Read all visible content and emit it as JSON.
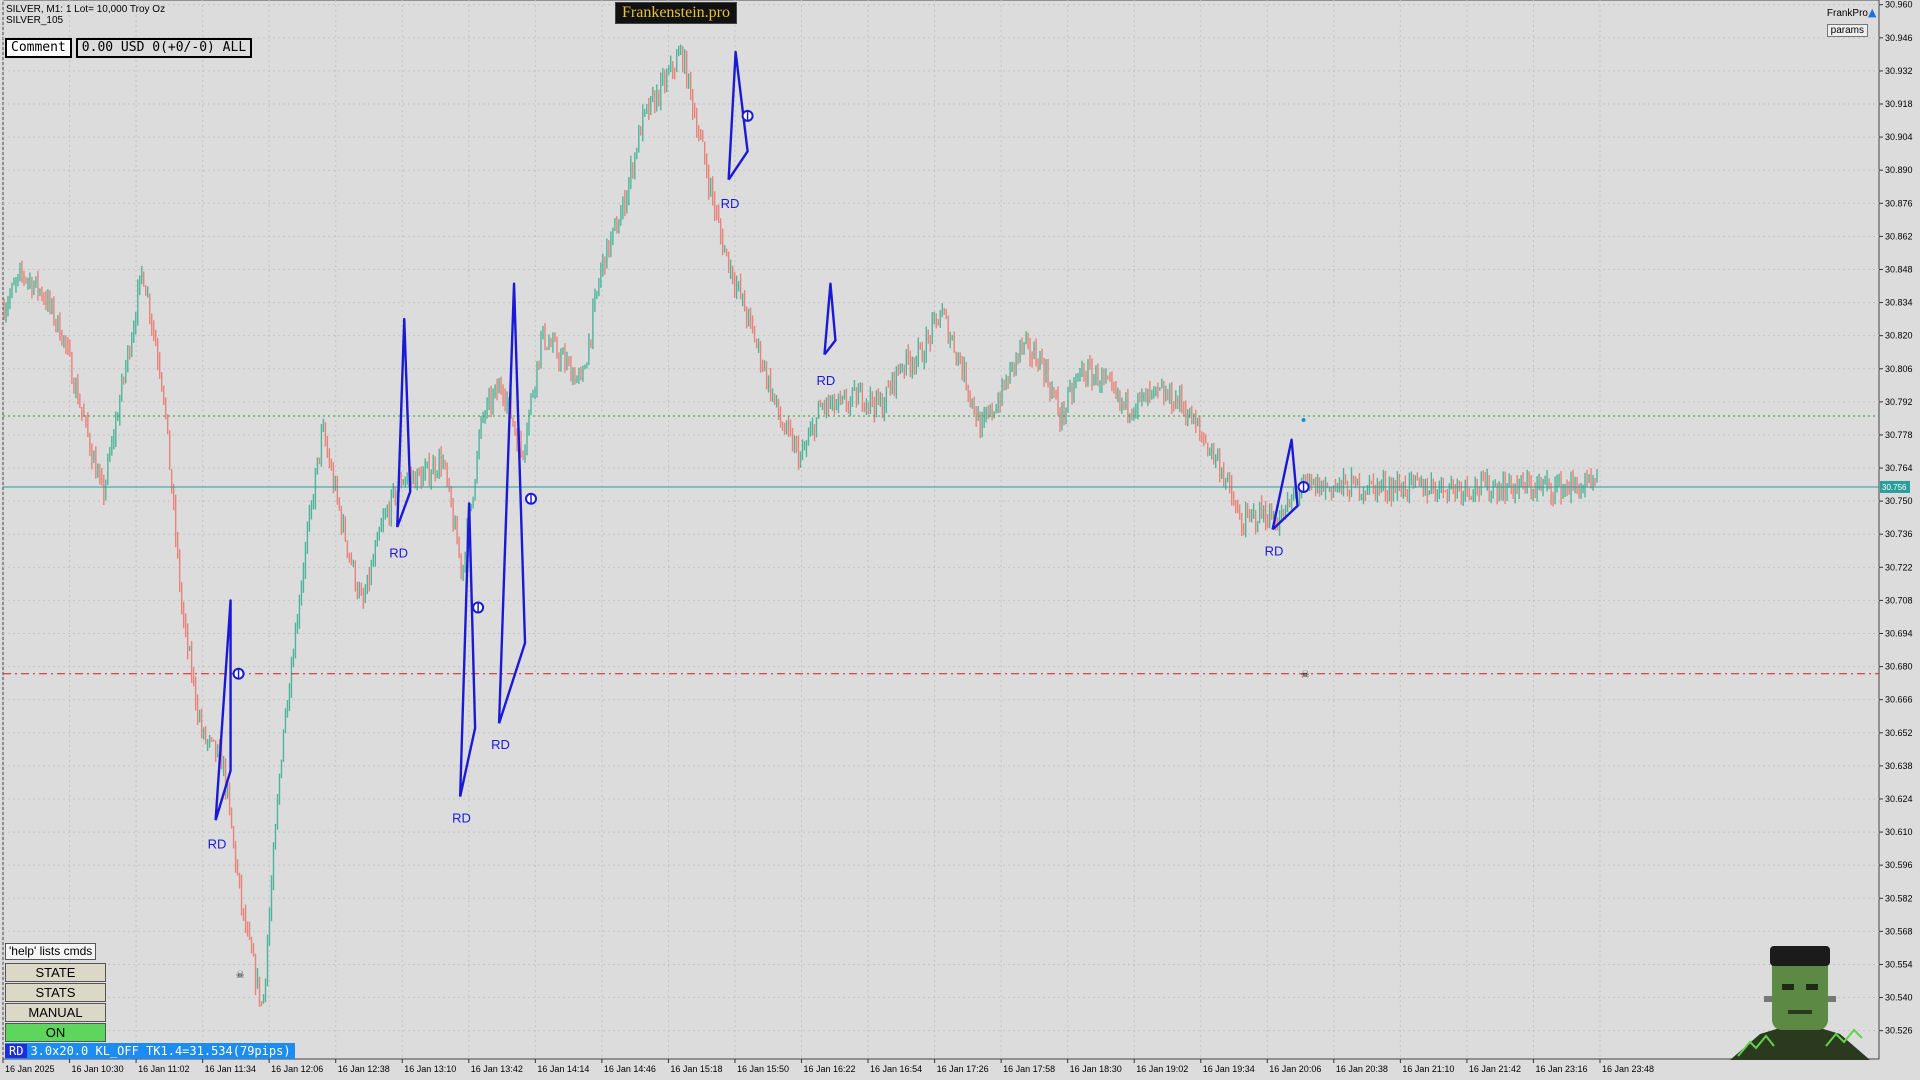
{
  "window": {
    "symbol_line": "SILVER, M1:  1 Lot= 10,000 Troy Oz",
    "sub_line": "SILVER_105",
    "brand": "Frankenstein.pro",
    "top_right_label": "FrankPro",
    "params_label": "params"
  },
  "comment": {
    "label": "Comment",
    "value": "0.00 USD 0(+0/-0) ALL"
  },
  "panel": {
    "help": "'help' lists cmds",
    "buttons": [
      "STATE",
      "STATS",
      "MANUAL",
      "ON"
    ],
    "status_tag": "RD",
    "status_text": "3.0x20.0 KL_OFF TK1.4=31.534(79pips)"
  },
  "colors": {
    "bull": "#4fb59a",
    "bear": "#e8837a",
    "pattern": "#1a1ad6",
    "bg": "#dcdcdc",
    "grid": "#c4c4c4",
    "green_level": "#2e9b2e",
    "red_level": "#d02020",
    "price_line": "#2a9d9d"
  },
  "chart_data": {
    "type": "line",
    "series": [
      {
        "x": [
          0,
          20,
          40,
          60,
          80,
          100,
          120,
          140,
          160,
          180,
          200,
          220,
          240,
          260,
          280,
          300,
          320,
          340,
          360,
          380,
          400,
          420,
          440,
          460,
          480,
          500,
          520,
          540,
          560,
          580,
          600,
          620,
          640,
          660,
          680,
          700,
          720,
          740,
          760,
          780,
          800,
          820,
          840,
          860,
          880,
          900,
          920,
          940,
          960,
          980,
          1000,
          1020,
          1040,
          1060,
          1080,
          1100,
          1120,
          1140,
          1160,
          1180,
          1200,
          1220,
          1240,
          1260,
          1280,
          1300,
          1320,
          1340,
          1360,
          1380,
          1400,
          1420,
          1440,
          1460,
          1480,
          1500,
          1520,
          1540,
          1560,
          1580,
          1600
        ],
        "values": [
          30.832,
          30.846,
          30.838,
          30.82,
          30.786,
          30.752,
          30.8,
          30.848,
          30.8,
          30.7,
          30.65,
          30.64,
          30.575,
          30.535,
          30.65,
          30.72,
          30.78,
          30.74,
          30.705,
          30.74,
          30.76,
          30.76,
          30.768,
          30.72,
          30.785,
          30.8,
          30.77,
          30.82,
          30.81,
          30.8,
          30.85,
          30.872,
          30.91,
          30.925,
          30.94,
          30.9,
          30.86,
          30.835,
          30.81,
          30.782,
          30.768,
          30.79,
          30.79,
          30.795,
          30.79,
          30.808,
          30.812,
          30.83,
          30.808,
          30.78,
          30.795,
          30.815,
          30.81,
          30.785,
          30.805,
          30.802,
          30.79,
          30.792,
          30.795,
          30.792,
          30.778,
          30.765,
          30.74,
          30.745,
          30.742,
          30.756,
          30.756,
          30.756,
          30.756,
          30.756,
          30.756,
          30.756,
          30.756,
          30.756,
          30.756,
          30.756,
          30.756,
          30.756,
          30.756,
          30.756,
          30.756
        ]
      }
    ],
    "x_tick_labels": [
      "16 Jan 2025",
      "16 Jan 10:30",
      "16 Jan 11:02",
      "16 Jan 11:34",
      "16 Jan 12:06",
      "16 Jan 12:38",
      "16 Jan 13:10",
      "16 Jan 13:42",
      "16 Jan 14:14",
      "16 Jan 14:46",
      "16 Jan 15:18",
      "16 Jan 15:50",
      "16 Jan 16:22",
      "16 Jan 16:54",
      "16 Jan 17:26",
      "16 Jan 17:58",
      "16 Jan 18:30",
      "16 Jan 19:02",
      "16 Jan 19:34",
      "16 Jan 20:06",
      "16 Jan 20:38",
      "16 Jan 21:10",
      "16 Jan 21:42",
      "16 Jan 23:16",
      "16 Jan 23:48"
    ],
    "y_tick_labels": [
      "30.960",
      "30.946",
      "30.932",
      "30.918",
      "30.904",
      "30.890",
      "30.876",
      "30.862",
      "30.848",
      "30.834",
      "30.820",
      "30.806",
      "30.792",
      "30.778",
      "30.764",
      "30.750",
      "30.736",
      "30.722",
      "30.708",
      "30.694",
      "30.680",
      "30.666",
      "30.652",
      "30.638",
      "30.624",
      "30.610",
      "30.596",
      "30.582",
      "30.568",
      "30.554",
      "30.540",
      "30.526"
    ],
    "ylim": [
      30.514,
      30.962
    ],
    "current_price": "30.756",
    "levels": [
      {
        "kind": "green-dotted",
        "price": 30.786
      },
      {
        "kind": "teal-solid",
        "price": 30.756
      },
      {
        "kind": "red-dashdot",
        "price": 30.677
      }
    ],
    "patterns": [
      {
        "label": "RD",
        "pts": [
          [
            213,
            30.615
          ],
          [
            228,
            30.708
          ],
          [
            228,
            30.636
          ],
          [
            213,
            30.615
          ]
        ],
        "label_price": 30.609,
        "marker": [
          236,
          30.677
        ]
      },
      {
        "label": "RD",
        "pts": [
          [
            395,
            30.739
          ],
          [
            402,
            30.827
          ],
          [
            408,
            30.754
          ],
          [
            395,
            30.739
          ]
        ],
        "label_price": 30.732,
        "marker": null
      },
      {
        "label": "RD",
        "pts": [
          [
            458,
            30.625
          ],
          [
            467,
            30.749
          ],
          [
            473,
            30.654
          ],
          [
            458,
            30.625
          ]
        ],
        "label_price": 30.62,
        "marker": [
          476,
          30.705
        ]
      },
      {
        "label": "RD",
        "pts": [
          [
            497,
            30.656
          ],
          [
            512,
            30.842
          ],
          [
            523,
            30.69
          ],
          [
            497,
            30.656
          ]
        ],
        "label_price": 30.651,
        "marker": [
          529,
          30.751
        ]
      },
      {
        "label": "RD",
        "pts": [
          [
            727,
            30.886
          ],
          [
            734,
            30.94
          ],
          [
            746,
            30.898
          ],
          [
            727,
            30.886
          ]
        ],
        "label_price": 30.88,
        "marker": [
          746,
          30.913
        ]
      },
      {
        "label": "RD",
        "pts": [
          [
            823,
            30.812
          ],
          [
            829,
            30.842
          ],
          [
            834,
            30.818
          ],
          [
            823,
            30.812
          ]
        ],
        "label_price": 30.805,
        "marker": null
      },
      {
        "label": "RD",
        "pts": [
          [
            1272,
            30.738
          ],
          [
            1291,
            30.776
          ],
          [
            1297,
            30.748
          ],
          [
            1272,
            30.738
          ]
        ],
        "label_price": 30.733,
        "marker": [
          1303,
          30.756
        ]
      }
    ],
    "grid": true
  }
}
